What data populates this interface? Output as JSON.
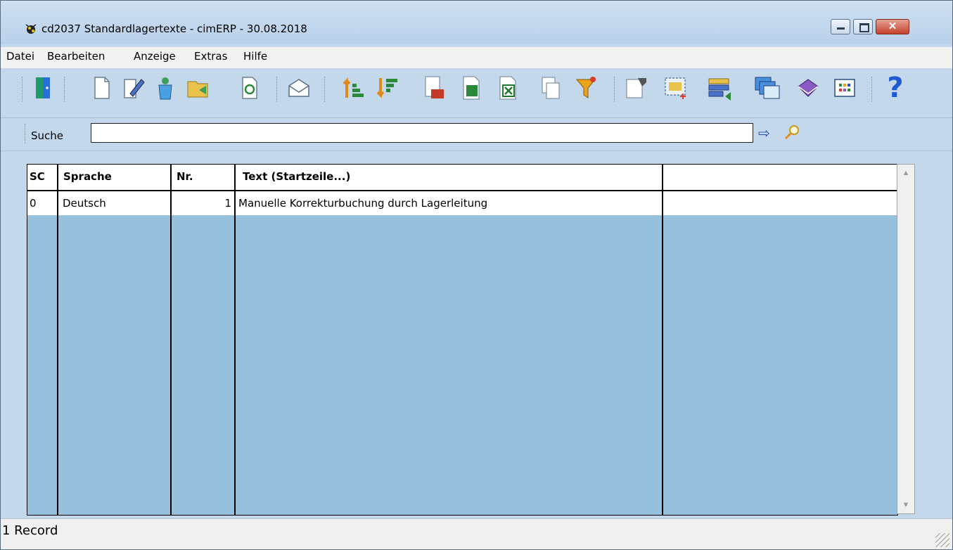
{
  "window": {
    "title": "cd2037 Standardlagertexte - cimERP - 30.08.2018",
    "close_label": "✕"
  },
  "menu": [
    "Datei",
    "Bearbeiten",
    "Anzeige",
    "Extras",
    "Hilfe"
  ],
  "toolbar": {
    "help_glyph": "?"
  },
  "search": {
    "label": "Suche",
    "value": ""
  },
  "table": {
    "columns": [
      "SC",
      "Sprache",
      "Nr.",
      "Text (Startzeile...)",
      ""
    ],
    "rows": [
      {
        "sc": "0",
        "sprache": "Deutsch",
        "nr": "1",
        "text": "Manuelle Korrekturbuchung durch Lagerleitung",
        "extra": ""
      }
    ]
  },
  "status": {
    "text": "1 Record"
  }
}
